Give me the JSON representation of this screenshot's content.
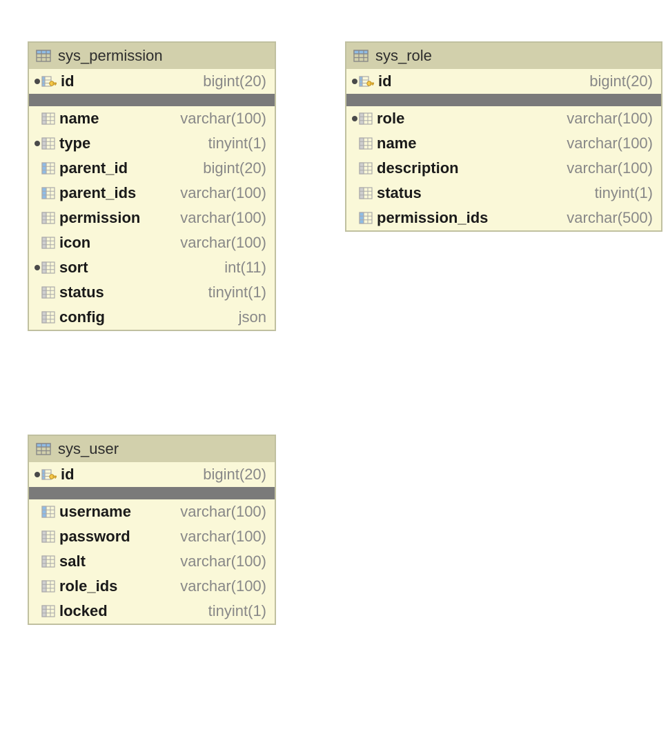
{
  "tables": [
    {
      "name": "sys_permission",
      "pk": {
        "name": "id",
        "type": "bigint(20)"
      },
      "columns": [
        {
          "name": "name",
          "type": "varchar(100)",
          "iconColor": "gray",
          "notNull": false
        },
        {
          "name": "type",
          "type": "tinyint(1)",
          "iconColor": "gray",
          "notNull": true
        },
        {
          "name": "parent_id",
          "type": "bigint(20)",
          "iconColor": "blue",
          "notNull": false
        },
        {
          "name": "parent_ids",
          "type": "varchar(100)",
          "iconColor": "blue",
          "notNull": false
        },
        {
          "name": "permission",
          "type": "varchar(100)",
          "iconColor": "gray",
          "notNull": false
        },
        {
          "name": "icon",
          "type": "varchar(100)",
          "iconColor": "gray",
          "notNull": false
        },
        {
          "name": "sort",
          "type": "int(11)",
          "iconColor": "gray",
          "notNull": true
        },
        {
          "name": "status",
          "type": "tinyint(1)",
          "iconColor": "gray",
          "notNull": false
        },
        {
          "name": "config",
          "type": "json",
          "iconColor": "gray",
          "notNull": false
        }
      ]
    },
    {
      "name": "sys_role",
      "pk": {
        "name": "id",
        "type": "bigint(20)"
      },
      "columns": [
        {
          "name": "role",
          "type": "varchar(100)",
          "iconColor": "gray",
          "notNull": true
        },
        {
          "name": "name",
          "type": "varchar(100)",
          "iconColor": "gray",
          "notNull": false
        },
        {
          "name": "description",
          "type": "varchar(100)",
          "iconColor": "gray",
          "notNull": false
        },
        {
          "name": "status",
          "type": "tinyint(1)",
          "iconColor": "gray",
          "notNull": false
        },
        {
          "name": "permission_ids",
          "type": "varchar(500)",
          "iconColor": "blue",
          "notNull": false
        }
      ]
    },
    {
      "name": "sys_user",
      "pk": {
        "name": "id",
        "type": "bigint(20)"
      },
      "columns": [
        {
          "name": "username",
          "type": "varchar(100)",
          "iconColor": "blue",
          "notNull": false
        },
        {
          "name": "password",
          "type": "varchar(100)",
          "iconColor": "gray",
          "notNull": false
        },
        {
          "name": "salt",
          "type": "varchar(100)",
          "iconColor": "gray",
          "notNull": false
        },
        {
          "name": "role_ids",
          "type": "varchar(100)",
          "iconColor": "gray",
          "notNull": false
        },
        {
          "name": "locked",
          "type": "tinyint(1)",
          "iconColor": "gray",
          "notNull": false
        }
      ]
    }
  ]
}
